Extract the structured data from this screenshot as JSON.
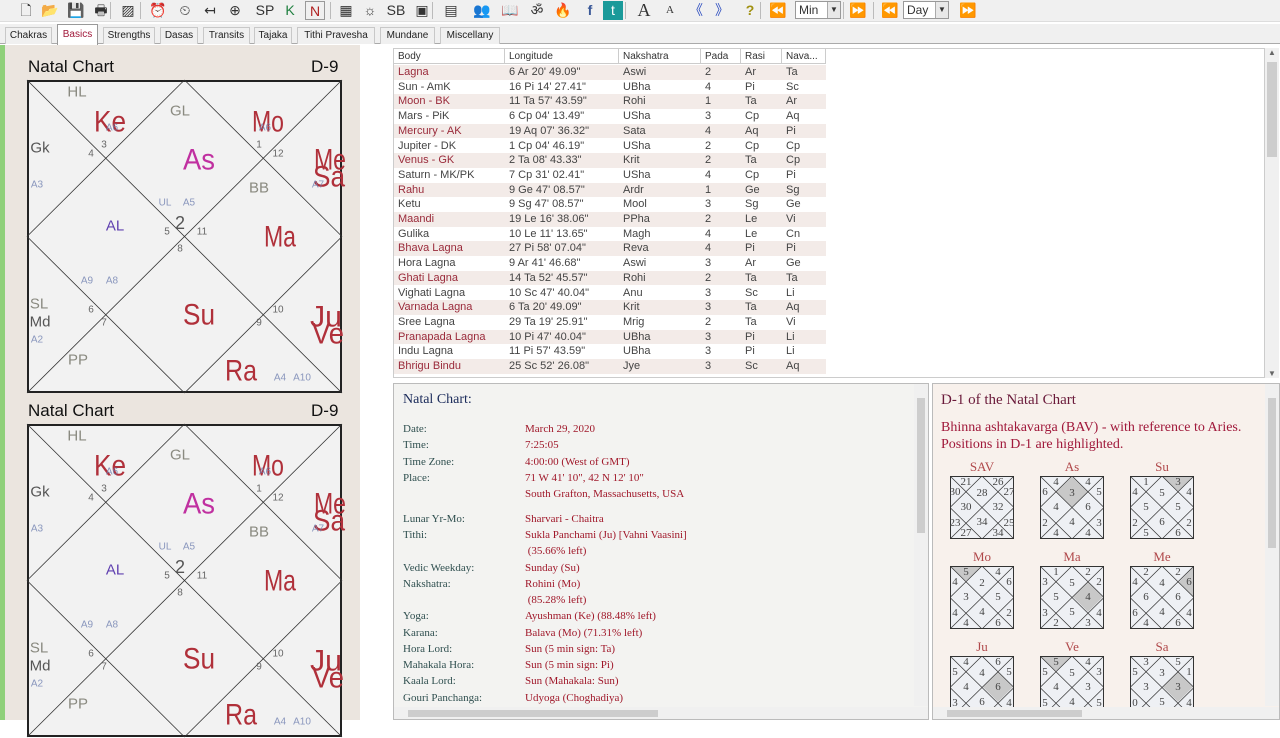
{
  "toolbar": {
    "icons": [
      "new-file-icon",
      "open-folder-icon",
      "save-icon",
      "print-icon",
      "chart-icon",
      "data-clock-icon",
      "time-reset-icon",
      "time-back-icon",
      "compass-icon",
      "sp-kh-icon",
      "k-icon",
      "n-icon",
      "grid-icon",
      "sun-icon",
      "sb-icon",
      "k-box-icon",
      "table-icon",
      "people-icon",
      "book-icon",
      "om-icon",
      "fire-icon",
      "facebook-icon",
      "twitter-icon",
      "font-larger-icon",
      "font-smaller-icon",
      "back-icon",
      "forward-icon",
      "help-icon"
    ],
    "step_unit": "Min",
    "step_unit2": "Day"
  },
  "tabs": [
    "Chakras",
    "Basics",
    "Strengths",
    "Dasas",
    "Transits",
    "Tajaka",
    "Tithi Pravesha",
    "Mundane",
    "Miscellany"
  ],
  "active_tab": "Basics",
  "charts": [
    {
      "title": "Natal Chart",
      "division": "D-9"
    },
    {
      "title": "Natal Chart",
      "division": "D-9"
    }
  ],
  "chart_items": [
    {
      "t": "HL",
      "kind": "special"
    },
    {
      "t": "Ke",
      "kind": "planet"
    },
    {
      "t": "A6",
      "kind": "arudha"
    },
    {
      "t": "3",
      "kind": "num"
    },
    {
      "t": "4",
      "kind": "num"
    },
    {
      "t": "GL",
      "kind": "special"
    },
    {
      "t": "Mo",
      "kind": "planet"
    },
    {
      "t": "A6",
      "kind": "arudha"
    },
    {
      "t": "1",
      "kind": "num"
    },
    {
      "t": "12",
      "kind": "num"
    },
    {
      "t": "Gk",
      "kind": "upa"
    },
    {
      "t": "As",
      "kind": "lagna"
    },
    {
      "t": "Me",
      "kind": "planet"
    },
    {
      "t": "Sa",
      "kind": "planet"
    },
    {
      "t": "A7",
      "kind": "arudha"
    },
    {
      "t": "A3",
      "kind": "arudha"
    },
    {
      "t": "BB",
      "kind": "special"
    },
    {
      "t": "UL",
      "kind": "arudha"
    },
    {
      "t": "A5",
      "kind": "arudha"
    },
    {
      "t": "2",
      "kind": "bignum"
    },
    {
      "t": "5",
      "kind": "num"
    },
    {
      "t": "11",
      "kind": "num"
    },
    {
      "t": "8",
      "kind": "num"
    },
    {
      "t": "AL",
      "kind": "al"
    },
    {
      "t": "Ma",
      "kind": "planet"
    },
    {
      "t": "A9",
      "kind": "arudha"
    },
    {
      "t": "A8",
      "kind": "arudha"
    },
    {
      "t": "SL",
      "kind": "special"
    },
    {
      "t": "Md",
      "kind": "upa"
    },
    {
      "t": "A2",
      "kind": "arudha"
    },
    {
      "t": "6",
      "kind": "num"
    },
    {
      "t": "7",
      "kind": "num"
    },
    {
      "t": "Su",
      "kind": "planet"
    },
    {
      "t": "10",
      "kind": "num"
    },
    {
      "t": "9",
      "kind": "num"
    },
    {
      "t": "Ju",
      "kind": "planet"
    },
    {
      "t": "Ve",
      "kind": "planet"
    },
    {
      "t": "PP",
      "kind": "special"
    },
    {
      "t": "Ra",
      "kind": "planet"
    },
    {
      "t": "A4",
      "kind": "arudha"
    },
    {
      "t": "A10",
      "kind": "arudha"
    }
  ],
  "table": {
    "headers": [
      "Body",
      "Longitude",
      "Nakshatra",
      "Pada",
      "Rasi",
      "Nava..."
    ],
    "rows": [
      [
        "Lagna",
        "6 Ar 20' 49.09\"",
        "Aswi",
        "2",
        "Ar",
        "Ta"
      ],
      [
        "Sun - AmK",
        "16 Pi 14' 27.41\"",
        "UBha",
        "4",
        "Pi",
        "Sc"
      ],
      [
        "Moon - BK",
        "11 Ta 57' 43.59\"",
        "Rohi",
        "1",
        "Ta",
        "Ar"
      ],
      [
        "Mars - PiK",
        "6 Cp 04' 13.49\"",
        "USha",
        "3",
        "Cp",
        "Aq"
      ],
      [
        "Mercury - AK",
        "19 Aq 07' 36.32\"",
        "Sata",
        "4",
        "Aq",
        "Pi"
      ],
      [
        "Jupiter - DK",
        "1 Cp 04' 46.19\"",
        "USha",
        "2",
        "Cp",
        "Cp"
      ],
      [
        "Venus - GK",
        "2 Ta 08' 43.33\"",
        "Krit",
        "2",
        "Ta",
        "Cp"
      ],
      [
        "Saturn - MK/PK",
        "7 Cp 31' 02.41\"",
        "USha",
        "4",
        "Cp",
        "Pi"
      ],
      [
        "Rahu",
        "9 Ge 47' 08.57\"",
        "Ardr",
        "1",
        "Ge",
        "Sg"
      ],
      [
        "Ketu",
        "9 Sg 47' 08.57\"",
        "Mool",
        "3",
        "Sg",
        "Ge"
      ],
      [
        "Maandi",
        "19 Le 16' 38.06\"",
        "PPha",
        "2",
        "Le",
        "Vi"
      ],
      [
        "Gulika",
        "10 Le 11' 13.65\"",
        "Magh",
        "4",
        "Le",
        "Cn"
      ],
      [
        "Bhava Lagna",
        "27 Pi 58' 07.04\"",
        "Reva",
        "4",
        "Pi",
        "Pi"
      ],
      [
        "Hora Lagna",
        "9 Ar 41' 46.68\"",
        "Aswi",
        "3",
        "Ar",
        "Ge"
      ],
      [
        "Ghati Lagna",
        "14 Ta 52' 45.57\"",
        "Rohi",
        "2",
        "Ta",
        "Ta"
      ],
      [
        "Vighati Lagna",
        "10 Sc 47' 40.04\"",
        "Anu",
        "3",
        "Sc",
        "Li"
      ],
      [
        "Varnada Lagna",
        "6 Ta 20' 49.09\"",
        "Krit",
        "3",
        "Ta",
        "Aq"
      ],
      [
        "Sree Lagna",
        "29 Ta 19' 25.91\"",
        "Mrig",
        "2",
        "Ta",
        "Vi"
      ],
      [
        "Pranapada Lagna",
        "10 Pi 47' 40.04\"",
        "UBha",
        "3",
        "Pi",
        "Li"
      ],
      [
        "Indu Lagna",
        "11 Pi 57' 43.59\"",
        "UBha",
        "3",
        "Pi",
        "Li"
      ],
      [
        "Bhrigu Bindu",
        "25 Sc 52' 26.08\"",
        "Jye",
        "3",
        "Sc",
        "Aq"
      ]
    ]
  },
  "details": {
    "title": "Natal Chart:",
    "rows": [
      {
        "label": "Date:",
        "value": "March 29, 2020"
      },
      {
        "label": "Time:",
        "value": "7:25:05"
      },
      {
        "label": "Time Zone:",
        "value": "4:00:00 (West of GMT)"
      },
      {
        "label": "Place:",
        "value": "71 W 41' 10\", 42 N 12' 10\""
      },
      {
        "label": "",
        "value": "South Grafton, Massachusetts, USA"
      },
      {
        "label": "Lunar Yr-Mo:",
        "value": "Sharvari - Chaitra"
      },
      {
        "label": "Tithi:",
        "value": "Sukla Panchami (Ju) [Vahni Vaasini]"
      },
      {
        "label": "",
        "value": " (35.66% left)"
      },
      {
        "label": "Vedic Weekday:",
        "value": "Sunday (Su)"
      },
      {
        "label": "Nakshatra:",
        "value": "Rohini (Mo)"
      },
      {
        "label": "",
        "value": " (85.28% left)"
      },
      {
        "label": "Yoga:",
        "value": "Ayushman (Ke) (88.48% left)"
      },
      {
        "label": "Karana:",
        "value": "Balava (Mo) (71.31% left)"
      },
      {
        "label": "Hora Lord:",
        "value": "Sun (5 min sign: Ta)"
      },
      {
        "label": "Mahakala Hora:",
        "value": "Sun (5 min sign: Pi)"
      },
      {
        "label": "Kaala Lord:",
        "value": "Sun (Mahakala: Sun)"
      },
      {
        "label": "Gouri Panchanga:",
        "value": "Udyoga (Choghadiya)"
      }
    ]
  },
  "bav": {
    "title": "D-1 of the Natal Chart",
    "subtitle": "Bhinna ashtakavarga (BAV) - with reference to Aries. Positions in D-1 are highlighted.",
    "charts": [
      {
        "name": "SAV",
        "vals": [
          28,
          21,
          30,
          30,
          23,
          27,
          34,
          34,
          25,
          32,
          27,
          26
        ],
        "hl": -1
      },
      {
        "name": "As",
        "vals": [
          3,
          4,
          6,
          4,
          2,
          4,
          4,
          4,
          3,
          6,
          5,
          4
        ],
        "hl": 0
      },
      {
        "name": "Su",
        "vals": [
          5,
          1,
          4,
          5,
          2,
          5,
          6,
          6,
          2,
          5,
          4,
          3
        ],
        "hl": 11
      },
      {
        "name": "Mo",
        "vals": [
          2,
          5,
          4,
          3,
          4,
          4,
          4,
          6,
          2,
          5,
          6,
          4
        ],
        "hl": 1
      },
      {
        "name": "Ma",
        "vals": [
          5,
          1,
          3,
          5,
          3,
          2,
          5,
          3,
          4,
          4,
          2,
          2
        ],
        "hl": 9
      },
      {
        "name": "Me",
        "vals": [
          4,
          2,
          4,
          6,
          6,
          4,
          4,
          6,
          4,
          6,
          6,
          2
        ],
        "hl": 10
      },
      {
        "name": "Ju",
        "vals": [
          4,
          4,
          5,
          4,
          3,
          4,
          6,
          5,
          4,
          6,
          5,
          6
        ],
        "hl": 9
      },
      {
        "name": "Ve",
        "vals": [
          5,
          5,
          5,
          4,
          5,
          5,
          4,
          4,
          5,
          3,
          3,
          4
        ],
        "hl": 1
      },
      {
        "name": "Sa",
        "vals": [
          3,
          3,
          5,
          3,
          0,
          3,
          5,
          4,
          4,
          3,
          1,
          5
        ],
        "hl": 9
      }
    ]
  },
  "colors": {
    "planet": "#b0303a",
    "lagna": "#c030a0",
    "arudha": "#7080b0",
    "special": "#8a8a80",
    "num": "#666666",
    "al": "#6040b0",
    "upa": "#555555",
    "value": "#a0182a",
    "label": "#2f4f4f"
  }
}
